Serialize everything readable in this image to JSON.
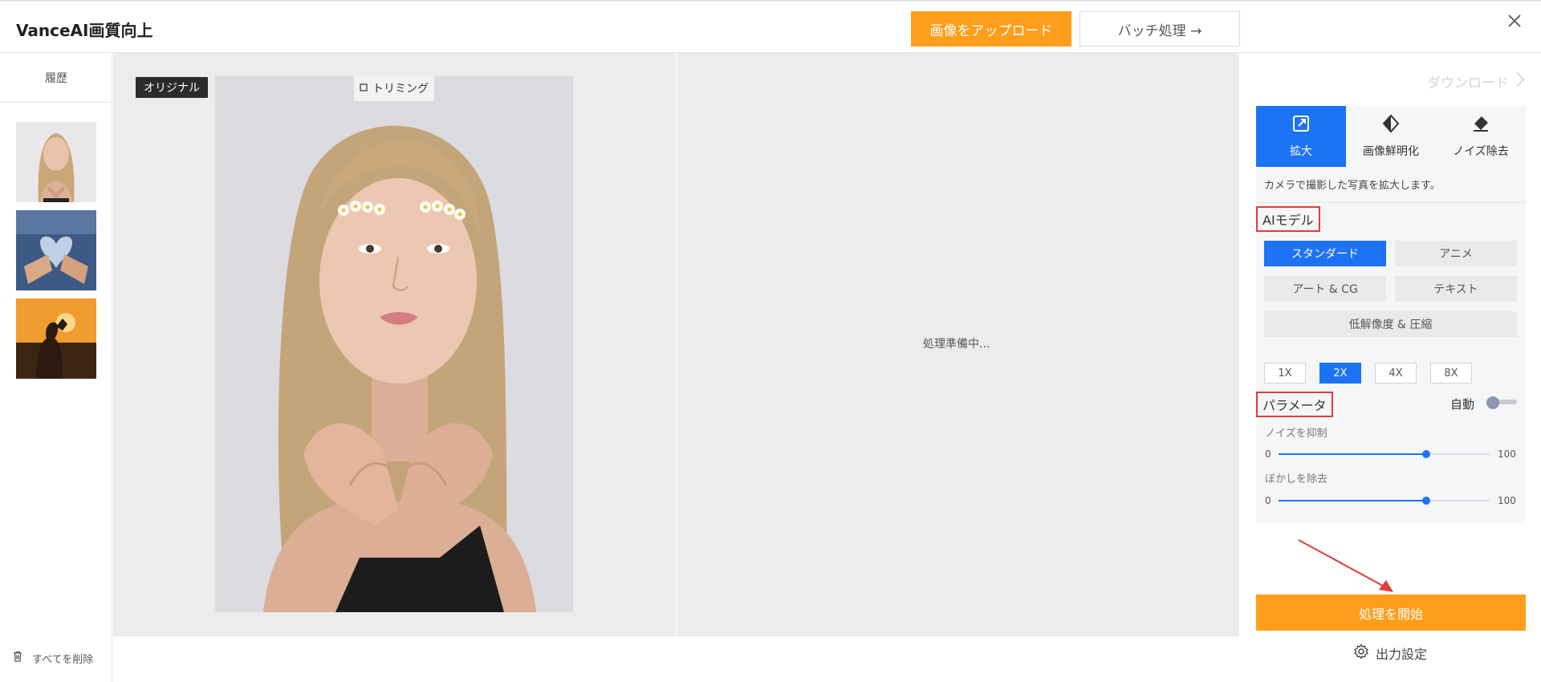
{
  "header": {
    "title": "VanceAI画質向上",
    "upload_label": "画像をアップロード",
    "batch_label": "バッチ処理 →",
    "close_icon": "close-icon"
  },
  "sidebar": {
    "history_label": "履歴",
    "thumbnails": [
      "portrait-heart-hands",
      "denim-heart-hands",
      "sunset-heart-hands"
    ],
    "delete_all_label": "すべてを削除"
  },
  "canvas": {
    "original_tag": "オリジナル",
    "crop_label": "トリミング",
    "processing_text": "処理準備中..."
  },
  "panel": {
    "download_label": "ダウンロード",
    "modes": [
      {
        "label": "拡大",
        "icon": "expand-icon",
        "active": true
      },
      {
        "label": "画像鮮明化",
        "icon": "sharpen-icon",
        "active": false
      },
      {
        "label": "ノイズ除去",
        "icon": "eraser-icon",
        "active": false
      }
    ],
    "description": "カメラで撮影した写真を拡大します。",
    "ai_model_label": "AIモデル",
    "models": [
      {
        "label": "スタンダード",
        "active": true
      },
      {
        "label": "アニメ",
        "active": false
      },
      {
        "label": "アート & CG",
        "active": false
      },
      {
        "label": "テキスト",
        "active": false
      },
      {
        "label": "低解像度 & 圧縮",
        "active": false
      }
    ],
    "scales": [
      {
        "label": "1X",
        "active": false
      },
      {
        "label": "2X",
        "active": true
      },
      {
        "label": "4X",
        "active": false
      },
      {
        "label": "8X",
        "active": false
      }
    ],
    "parameters_label": "パラメータ",
    "auto_label": "自動",
    "auto_enabled": false,
    "noise_label": "ノイズを抑制",
    "noise_min": "0",
    "noise_max": "100",
    "noise_value": 70,
    "blur_label": "ぼかしを除去",
    "blur_min": "0",
    "blur_max": "100",
    "blur_value": 70,
    "start_label": "処理を開始",
    "output_settings_label": "出力設定"
  },
  "colors": {
    "accent_orange": "#ff9e1b",
    "accent_blue": "#1d73f5",
    "highlight_red": "#e23b3b"
  }
}
